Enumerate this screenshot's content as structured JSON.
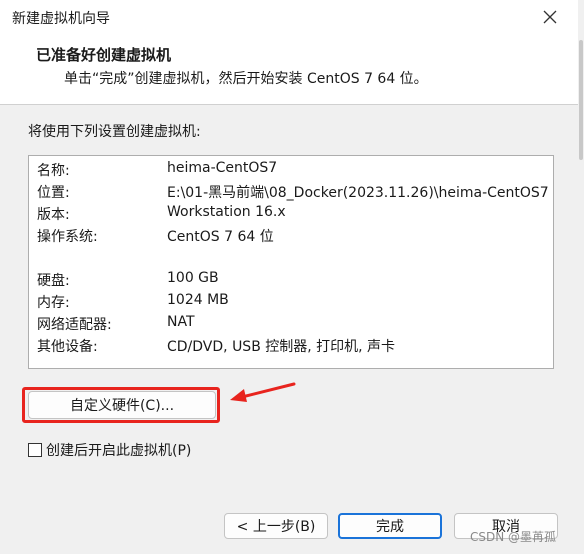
{
  "window": {
    "title": "新建虚拟机向导"
  },
  "header": {
    "title": "已准备好创建虚拟机",
    "subtitle": "单击“完成”创建虚拟机，然后开始安装 CentOS 7 64 位。"
  },
  "section_label": "将使用下列设置创建虚拟机:",
  "summary": [
    {
      "key": "名称:",
      "value": "heima-CentOS7"
    },
    {
      "key": "位置:",
      "value": "E:\\01-黑马前端\\08_Docker(2023.11.26)\\heima-CentOS7"
    },
    {
      "key": "版本:",
      "value": "Workstation 16.x"
    },
    {
      "key": "操作系统:",
      "value": "CentOS 7 64 位"
    },
    {
      "key": "硬盘:",
      "value": "100 GB"
    },
    {
      "key": "内存:",
      "value": "1024 MB"
    },
    {
      "key": "网络适配器:",
      "value": "NAT"
    },
    {
      "key": "其他设备:",
      "value": "CD/DVD, USB 控制器, 打印机, 声卡"
    }
  ],
  "buttons": {
    "customize": "自定义硬件(C)...",
    "back": "< 上一步(B)",
    "finish": "完成",
    "cancel": "取消"
  },
  "checkbox": {
    "label": "创建后开启此虚拟机(P)",
    "checked": false
  },
  "watermark": "CSDN @墨苒孤",
  "colors": {
    "highlight": "#e8241e",
    "default_button_border": "#1a73d9"
  }
}
